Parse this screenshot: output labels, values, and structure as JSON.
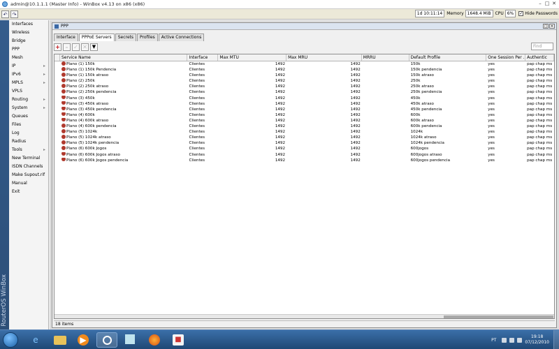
{
  "window": {
    "title": "admin@10.1.1.1 (Master Info) - WinBox v4.13 on x86 (x86)"
  },
  "toolbar": {
    "undo_icon": "undo-icon",
    "redo_icon": "redo-icon",
    "uptime": "1d 10:11:14",
    "memory_label": "Memory",
    "memory_value": "1648.4 MiB",
    "cpu_label": "CPU",
    "cpu_value": "6%",
    "hide_passwords_label": "Hide Passwords",
    "hide_passwords_checked": true
  },
  "sidebar": {
    "brand": "RouterOS WinBox",
    "items": [
      {
        "label": "Interfaces",
        "arrow": false
      },
      {
        "label": "Wireless",
        "arrow": false
      },
      {
        "label": "Bridge",
        "arrow": false
      },
      {
        "label": "PPP",
        "arrow": false
      },
      {
        "label": "Mesh",
        "arrow": false
      },
      {
        "label": "IP",
        "arrow": true
      },
      {
        "label": "IPv6",
        "arrow": true
      },
      {
        "label": "MPLS",
        "arrow": true
      },
      {
        "label": "VPLS",
        "arrow": false
      },
      {
        "label": "Routing",
        "arrow": true
      },
      {
        "label": "System",
        "arrow": true
      },
      {
        "label": "Queues",
        "arrow": false
      },
      {
        "label": "Files",
        "arrow": false
      },
      {
        "label": "Log",
        "arrow": false
      },
      {
        "label": "Radius",
        "arrow": false
      },
      {
        "label": "Tools",
        "arrow": true
      },
      {
        "label": "New Terminal",
        "arrow": false
      },
      {
        "label": "ISDN Channels",
        "arrow": false
      },
      {
        "label": "Make Supout.rif",
        "arrow": false
      },
      {
        "label": "Manual",
        "arrow": false
      },
      {
        "label": "Exit",
        "arrow": false
      }
    ]
  },
  "ppp_window": {
    "title": "PPP",
    "tabs": [
      "Interface",
      "PPPoE Servers",
      "Secrets",
      "Profiles",
      "Active Connections"
    ],
    "active_tab": 1,
    "find_placeholder": "Find",
    "columns": [
      "Service Name",
      "Interface",
      "Max MTU",
      "Max MRU",
      "MRRU",
      "Default Profile",
      "One Session Per ...",
      "Authentic"
    ],
    "rows": [
      [
        "Plano (1) 150k",
        "Clientes",
        "1492",
        "1492",
        "",
        "150k",
        "yes",
        "pap chap ms"
      ],
      [
        "Plano (1) 150k Pendencia",
        "Clientes",
        "1492",
        "1492",
        "",
        "150k pendencia",
        "yes",
        "pap chap ms"
      ],
      [
        "Plano (1) 150k atraso",
        "Clientes",
        "1492",
        "1492",
        "",
        "150k atraso",
        "yes",
        "pap chap ms"
      ],
      [
        "Plano (2) 250k",
        "Clientes",
        "1492",
        "1492",
        "",
        "250k",
        "yes",
        "pap chap ms"
      ],
      [
        "Plano (2) 250k atraso",
        "Clientes",
        "1492",
        "1492",
        "",
        "250k atraso",
        "yes",
        "pap chap ms"
      ],
      [
        "Plano (2) 250k pendencia",
        "Clientes",
        "1492",
        "1492",
        "",
        "250k pendencia",
        "yes",
        "pap chap ms"
      ],
      [
        "Plano (3) 450k",
        "Clientes",
        "1492",
        "1492",
        "",
        "450k",
        "yes",
        "pap chap ms"
      ],
      [
        "Plano (3) 450k atraso",
        "Clientes",
        "1492",
        "1492",
        "",
        "450k atraso",
        "yes",
        "pap chap ms"
      ],
      [
        "Plano (3) 450k pendencia",
        "Clientes",
        "1492",
        "1492",
        "",
        "450k pendencia",
        "yes",
        "pap chap ms"
      ],
      [
        "Plano (4) 600k",
        "Clientes",
        "1492",
        "1492",
        "",
        "600k",
        "yes",
        "pap chap ms"
      ],
      [
        "Plano (4) 600k atraso",
        "Clientes",
        "1492",
        "1492",
        "",
        "600k atraso",
        "yes",
        "pap chap ms"
      ],
      [
        "Plano (4) 600k pendencia",
        "Clientes",
        "1492",
        "1492",
        "",
        "600k pendencia",
        "yes",
        "pap chap ms"
      ],
      [
        "Plano (5) 1024k",
        "Clientes",
        "1492",
        "1492",
        "",
        "1024k",
        "yes",
        "pap chap ms"
      ],
      [
        "Plano (5) 1024k atraso",
        "Clientes",
        "1492",
        "1492",
        "",
        "1024k atraso",
        "yes",
        "pap chap ms"
      ],
      [
        "Plano (5) 1024k pendencia",
        "Clientes",
        "1492",
        "1492",
        "",
        "1024k pendencia",
        "yes",
        "pap chap ms"
      ],
      [
        "Plano (6) 600k Jogos",
        "Clientes",
        "1492",
        "1492",
        "",
        "600jogos",
        "yes",
        "pap chap ms"
      ],
      [
        "Plano (6) 600k Jogos atraso",
        "Clientes",
        "1492",
        "1492",
        "",
        "600jogos atraso",
        "yes",
        "pap chap ms"
      ],
      [
        "Plano (6) 600k Jogos pendencia",
        "Clientes",
        "1492",
        "1492",
        "",
        "600jogos pendencia",
        "yes",
        "pap chap ms"
      ]
    ],
    "status": "18 items"
  },
  "taskbar": {
    "apps": [
      "internet-explorer-icon",
      "folder-icon",
      "media-player-icon",
      "winbox-icon",
      "notepad-icon",
      "firefox-icon",
      "paint-icon"
    ],
    "language": "PT",
    "time": "19:18",
    "date": "07/12/2010"
  }
}
